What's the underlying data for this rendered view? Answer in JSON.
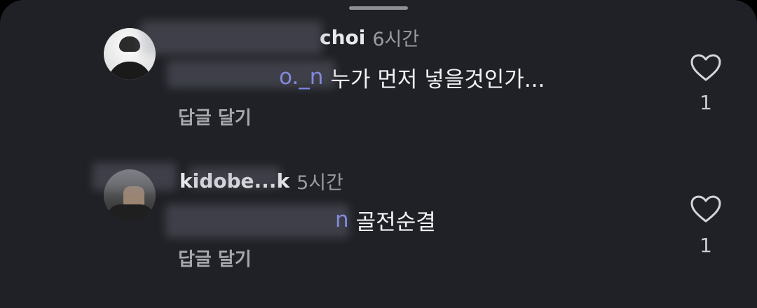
{
  "sheet": {
    "grabber": ""
  },
  "comments": [
    {
      "username": "*****choi",
      "username_visible": "choi",
      "time": "6시간",
      "mention": "@***_n",
      "mention_visible": "o._n",
      "text": "누가 먼저 넣을것인가...",
      "reply_label": "답글 달기",
      "like_count": "1"
    },
    {
      "username": "kidobe***k",
      "username_visible": "kidobe...k",
      "time": "5시간",
      "mention": "@***n",
      "mention_visible": "n",
      "text": "골전순결",
      "reply_label": "답글 달기",
      "like_count": "1"
    }
  ],
  "icons": {
    "like": "heart-outline-icon"
  },
  "colors": {
    "background": "#202126",
    "mention": "#7f86f0",
    "text": "#f3f3f5",
    "muted": "#a6a6ad"
  }
}
